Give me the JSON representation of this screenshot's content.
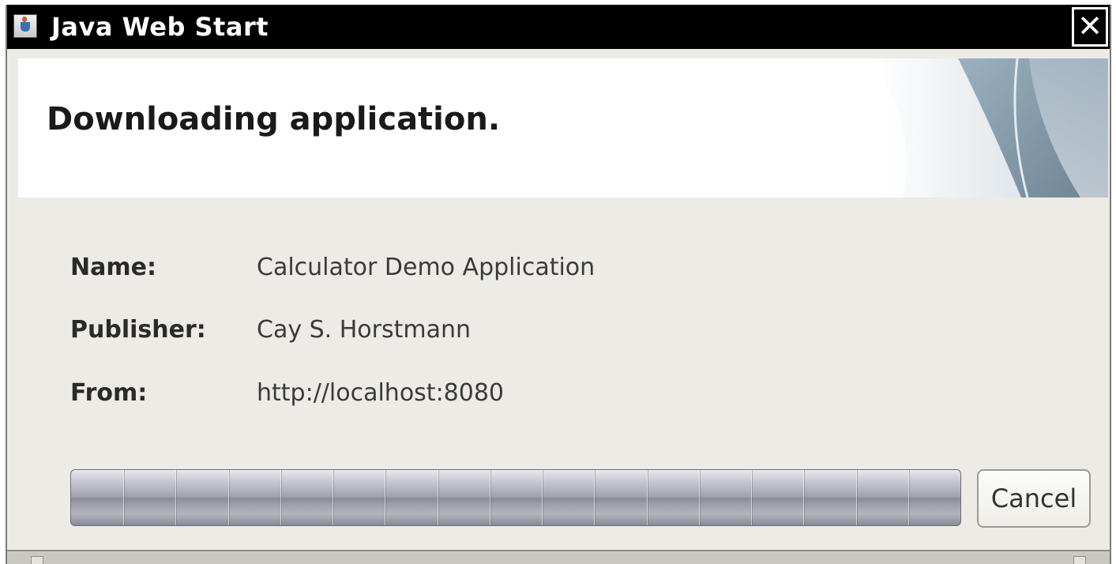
{
  "window": {
    "title": "Java Web Start",
    "close_glyph": "✕",
    "icon": "java-cup-icon"
  },
  "banner": {
    "heading": "Downloading application."
  },
  "info": {
    "name_label": "Name:",
    "name_value": "Calculator Demo Application",
    "publisher_label": "Publisher:",
    "publisher_value": "Cay S. Horstmann",
    "from_label": "From:",
    "from_value": "http://localhost:8080"
  },
  "progress": {
    "mode": "indeterminate",
    "segments": 17
  },
  "buttons": {
    "cancel_label": "Cancel"
  },
  "colors": {
    "titlebar": "#000000",
    "dialog_background": "#ecebe6",
    "banner_background": "#ffffff"
  }
}
